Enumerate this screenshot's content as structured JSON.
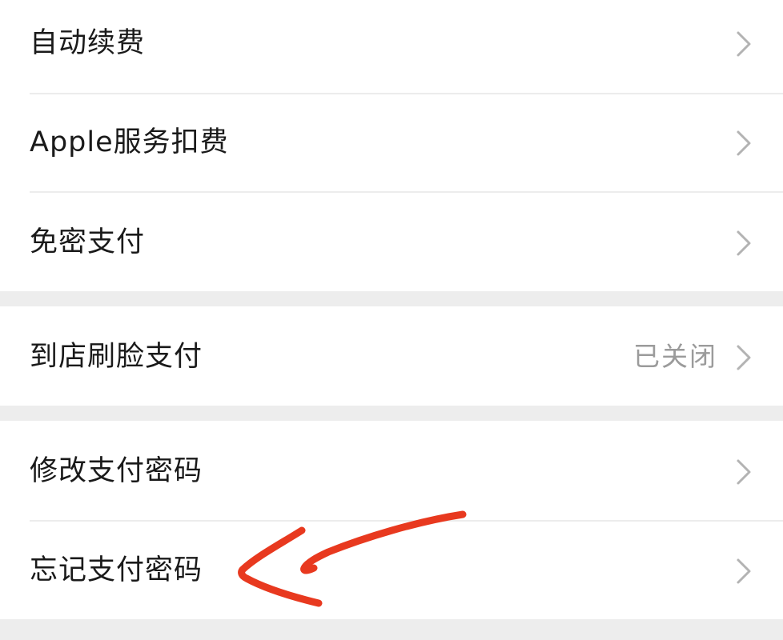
{
  "settings": {
    "group1": [
      {
        "label": "自动续费"
      },
      {
        "label": "Apple服务扣费"
      },
      {
        "label": "免密支付"
      }
    ],
    "group2": [
      {
        "label": "到店刷脸支付",
        "value": "已关闭"
      }
    ],
    "group3": [
      {
        "label": "修改支付密码"
      },
      {
        "label": "忘记支付密码"
      }
    ]
  },
  "icons": {
    "row_chevron": "chevron-right-icon"
  },
  "colors": {
    "background": "#ededed",
    "row_background": "#ffffff",
    "label_text": "#1a1a1a",
    "value_text": "#9b9b9b",
    "chevron": "#b3b3b3",
    "annotation_arrow": "#e8391f"
  }
}
